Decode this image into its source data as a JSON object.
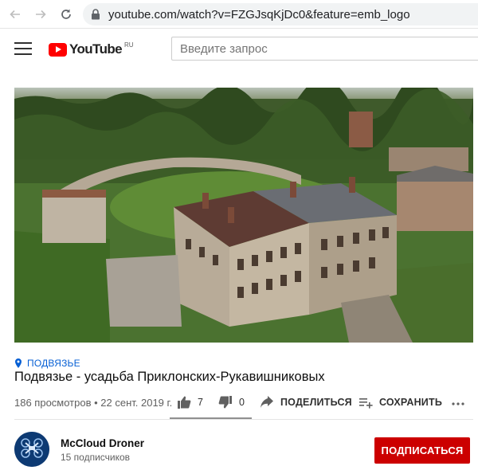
{
  "browser": {
    "url": "youtube.com/watch?v=FZGJsqKjDc0&feature=emb_logo"
  },
  "header": {
    "logo_text": "YouTube",
    "region": "RU",
    "search_placeholder": "Введите запрос"
  },
  "video": {
    "location": "ПОДВЯЗЬЕ",
    "title": "Подвязье - усадьба Приклонских-Рукавишниковых",
    "stats": "186 просмотров • 22 сент. 2019 г.",
    "likes": "7",
    "dislikes": "0",
    "share_label": "ПОДЕЛИТЬСЯ",
    "save_label": "СОХРАНИТЬ"
  },
  "channel": {
    "name": "McCloud Droner",
    "subscribers": "15 подписчиков",
    "subscribe_label": "ПОДПИСАТЬСЯ"
  },
  "colors": {
    "brand_red": "#ff0000",
    "subscribe_red": "#cc0000",
    "link_blue": "#065fd4"
  }
}
